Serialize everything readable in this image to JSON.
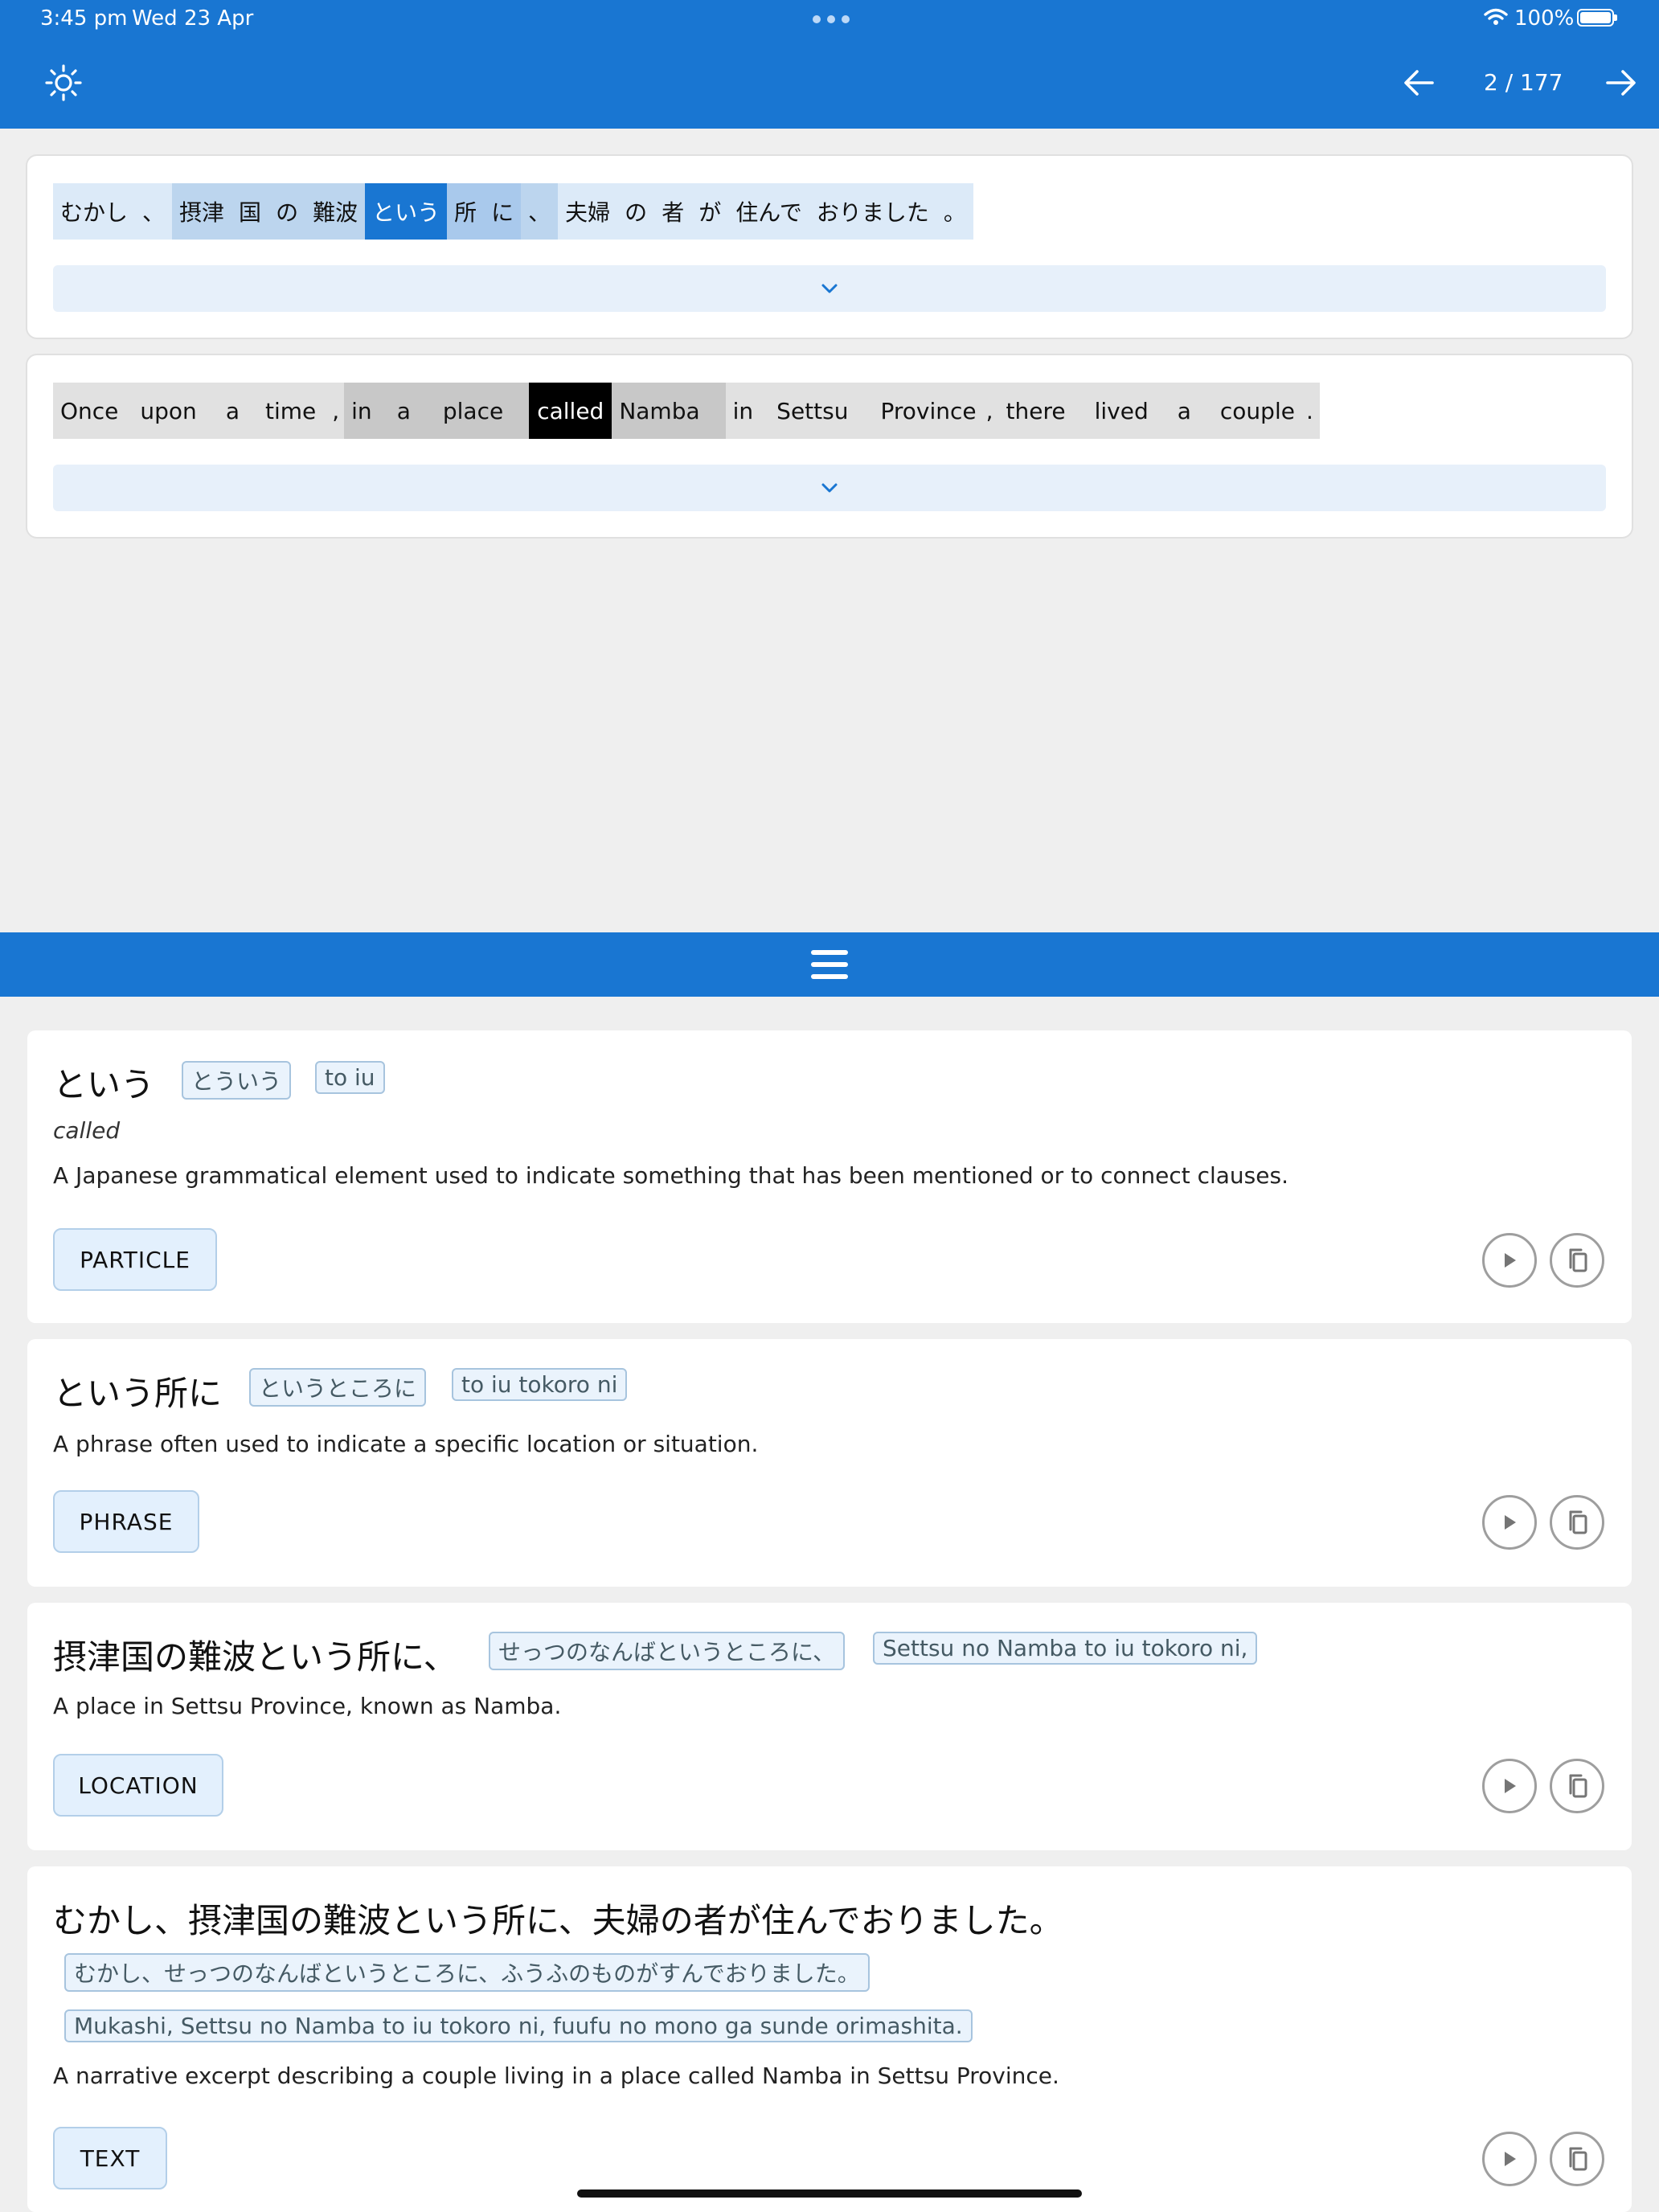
{
  "status": {
    "time": "3:45 pm",
    "date": "Wed 23 Apr",
    "battery": "100%"
  },
  "toolbar": {
    "page_indicator": "2 / 177"
  },
  "sentences": {
    "japanese": [
      "むかし",
      "、",
      "摂津",
      "国",
      "の",
      "難波",
      "という",
      "所",
      "に",
      "、",
      "夫婦",
      "の",
      "者",
      "が",
      "住んで",
      "おりました",
      "。"
    ],
    "english": [
      "Once",
      "upon",
      "a",
      "time",
      ",",
      "in",
      "a",
      "place",
      "called",
      "Namba",
      "in",
      "Settsu",
      "Province",
      ",",
      "there",
      "lived",
      "a",
      "couple",
      "."
    ]
  },
  "entries": [
    {
      "term": "という",
      "reading": "とういう",
      "romaji": "to iu",
      "gloss": "called",
      "definition": "A Japanese grammatical element used to indicate something that has been mentioned or to connect clauses.",
      "category": "PARTICLE"
    },
    {
      "term": "という所に",
      "reading": "というところに",
      "romaji": "to iu tokoro ni",
      "definition": "A phrase often used to indicate a specific location or situation.",
      "category": "PHRASE"
    },
    {
      "term": "摂津国の難波という所に、",
      "reading": "せっつのなんばというところに、",
      "romaji": "Settsu no Namba to iu tokoro ni,",
      "definition": "A place in Settsu Province, known as Namba.",
      "category": "LOCATION"
    },
    {
      "term": "むかし、摂津国の難波という所に、夫婦の者が住んでおりました。",
      "reading": "むかし、せっつのなんばというところに、ふうふのものがすんでおりました。",
      "romaji": "Mukashi, Settsu no Namba to iu tokoro ni, fuufu no mono ga sunde orimashita.",
      "definition": "A narrative excerpt describing a couple living in a place called Namba in Settsu Province.",
      "category": "TEXT"
    }
  ],
  "colors": {
    "accent": "#1976d2",
    "background": "#efefef",
    "selected_en": "#000000"
  },
  "icons": {
    "theme": "sun-icon",
    "prev": "arrow-left-icon",
    "next": "arrow-right-icon",
    "expand": "chevron-down-icon",
    "menu": "hamburger-menu-icon",
    "play": "play-icon",
    "copy": "copy-icon"
  }
}
